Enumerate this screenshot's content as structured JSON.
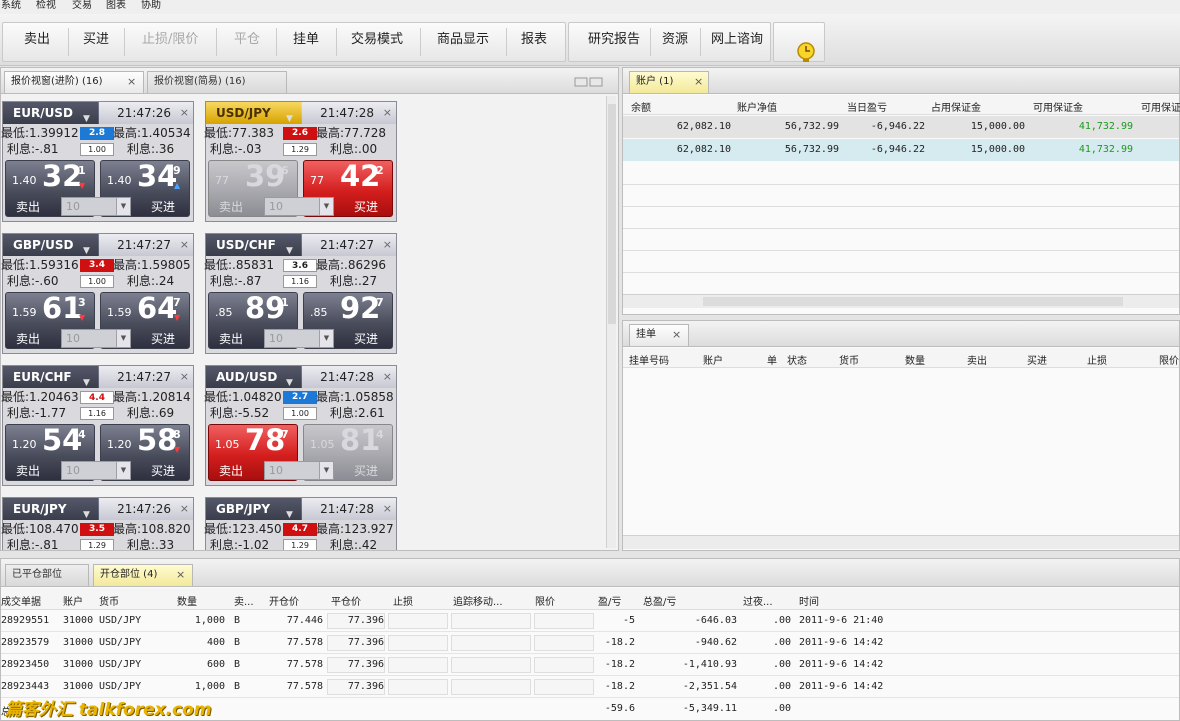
{
  "menu": [
    "系统",
    "检视",
    "交易",
    "图表",
    "协助"
  ],
  "toolbar": {
    "buttons": [
      {
        "label": "卖出",
        "enabled": true
      },
      {
        "label": "买进",
        "enabled": true
      },
      {
        "label": "止损/限价",
        "enabled": false
      },
      {
        "label": "平仓",
        "enabled": false
      },
      {
        "label": "挂单",
        "enabled": true
      },
      {
        "label": "交易模式",
        "enabled": true
      },
      {
        "label": "商品显示",
        "enabled": true
      },
      {
        "label": "报表",
        "enabled": true
      },
      {
        "label": "研究报告",
        "enabled": true
      },
      {
        "label": "资源",
        "enabled": true
      },
      {
        "label": "网上谘询",
        "enabled": true
      }
    ],
    "clock_icon": "clock-icon"
  },
  "quotes_panel": {
    "tabs": [
      {
        "label": "报价视窗(进阶) (16)",
        "active": true
      },
      {
        "label": "报价视窗(简易) (16)",
        "active": false
      }
    ],
    "close_icon": "×",
    "cards": [
      {
        "symbol": "EUR/USD",
        "time": "21:47:26",
        "low": "最低:1.39912",
        "high": "最高:1.40534",
        "spread": "2.8",
        "spread_color": "blue",
        "int_a": "利息:-.81",
        "lot": "1.00",
        "int_b": "利息:.36",
        "sell_small": "1.40",
        "sell_main": "32",
        "sell_sup": "1",
        "sell_dir": "down",
        "sell_label": "卖出",
        "buy_small": "1.40",
        "buy_main": "34",
        "buy_sup": "9",
        "buy_dir": "up",
        "buy_label": "买进",
        "amount": "10",
        "state": "normal",
        "highlight": false
      },
      {
        "symbol": "USD/JPY",
        "time": "21:47:28",
        "low": "最低:77.383",
        "high": "最高:77.728",
        "spread": "2.6",
        "spread_color": "red",
        "int_a": "利息:-.03",
        "lot": "1.29",
        "int_b": "利息:.00",
        "sell_small": "77",
        "sell_main": "39",
        "sell_sup": "6",
        "sell_dir": "",
        "sell_label": "卖出",
        "buy_small": "77",
        "buy_main": "42",
        "buy_sup": "2",
        "buy_dir": "",
        "buy_label": "买进",
        "amount": "10",
        "state": "buy-red",
        "highlight": true
      },
      {
        "symbol": "GBP/USD",
        "time": "21:47:27",
        "low": "最低:1.59316",
        "high": "最高:1.59805",
        "spread": "3.4",
        "spread_color": "red",
        "int_a": "利息:-.60",
        "lot": "1.00",
        "int_b": "利息:.24",
        "sell_small": "1.59",
        "sell_main": "61",
        "sell_sup": "3",
        "sell_dir": "down",
        "sell_label": "卖出",
        "buy_small": "1.59",
        "buy_main": "64",
        "buy_sup": "7",
        "buy_dir": "down",
        "buy_label": "买进",
        "amount": "10",
        "state": "normal",
        "highlight": false
      },
      {
        "symbol": "USD/CHF",
        "time": "21:47:27",
        "low": "最低:.85831",
        "high": "最高:.86296",
        "spread": "3.6",
        "spread_color": "white",
        "int_a": "利息:-.87",
        "lot": "1.16",
        "int_b": "利息:.27",
        "sell_small": ".85",
        "sell_main": "89",
        "sell_sup": "1",
        "sell_dir": "",
        "sell_label": "卖出",
        "buy_small": ".85",
        "buy_main": "92",
        "buy_sup": "7",
        "buy_dir": "",
        "buy_label": "买进",
        "amount": "10",
        "state": "normal",
        "highlight": false
      },
      {
        "symbol": "EUR/CHF",
        "time": "21:47:27",
        "low": "最低:1.20463",
        "high": "最高:1.20814",
        "spread": "4.4",
        "spread_color": "white-red",
        "int_a": "利息:-1.77",
        "lot": "1.16",
        "int_b": "利息:.69",
        "sell_small": "1.20",
        "sell_main": "54",
        "sell_sup": "4",
        "sell_dir": "",
        "sell_label": "卖出",
        "buy_small": "1.20",
        "buy_main": "58",
        "buy_sup": "8",
        "buy_dir": "down",
        "buy_label": "买进",
        "amount": "10",
        "state": "normal",
        "highlight": false
      },
      {
        "symbol": "AUD/USD",
        "time": "21:47:28",
        "low": "最低:1.04820",
        "high": "最高:1.05858",
        "spread": "2.7",
        "spread_color": "blue",
        "int_a": "利息:-5.52",
        "lot": "1.00",
        "int_b": "利息:2.61",
        "sell_small": "1.05",
        "sell_main": "78",
        "sell_sup": "7",
        "sell_dir": "",
        "sell_label": "卖出",
        "buy_small": "1.05",
        "buy_main": "81",
        "buy_sup": "4",
        "buy_dir": "",
        "buy_label": "买进",
        "amount": "10",
        "state": "sell-red",
        "highlight": false
      },
      {
        "symbol": "EUR/JPY",
        "time": "21:47:26",
        "low": "最低:108.470",
        "high": "最高:108.820",
        "spread": "3.5",
        "spread_color": "red",
        "int_a": "利息:-.81",
        "lot": "1.29",
        "int_b": "利息:.33",
        "highlight": false
      },
      {
        "symbol": "GBP/JPY",
        "time": "21:47:28",
        "low": "最低:123.450",
        "high": "最高:123.927",
        "spread": "4.7",
        "spread_color": "red",
        "int_a": "利息:-1.02",
        "lot": "1.29",
        "int_b": "利息:.42",
        "highlight": false
      }
    ]
  },
  "account_panel": {
    "tab": "账户 (1)",
    "columns": [
      "余额",
      "账户净值",
      "当日盈亏",
      "占用保证金",
      "可用保证金",
      "可用保证"
    ],
    "rows": [
      [
        "62,082.10",
        "56,732.99",
        "-6,946.22",
        "15,000.00",
        "41,732.99"
      ],
      [
        "62,082.10",
        "56,732.99",
        "-6,946.22",
        "15,000.00",
        "41,732.99"
      ]
    ]
  },
  "orders_panel": {
    "tab": "挂单",
    "columns": [
      "挂单号码",
      "账户",
      "单",
      "状态",
      "货币",
      "数量",
      "卖出",
      "买进",
      "止损",
      "限价"
    ]
  },
  "positions_panel": {
    "tabs": [
      {
        "label": "已平仓部位",
        "active": false
      },
      {
        "label": "开仓部位 (4)",
        "active": true
      }
    ],
    "columns": [
      "成交单据",
      "账户",
      "货币",
      "数量",
      "卖...",
      "开仓价",
      "平仓价",
      "止损",
      "追踪移动...",
      "限价",
      "盈/亏",
      "总盈/亏",
      "过夜...",
      "时间"
    ],
    "rows": [
      [
        "28929551",
        "31000",
        "USD/JPY",
        "1,000",
        "B",
        "77.446",
        "77.396",
        "-5",
        "-646.03",
        ".00",
        "2011-9-6 21:40"
      ],
      [
        "28923579",
        "31000",
        "USD/JPY",
        "400",
        "B",
        "77.578",
        "77.396",
        "-18.2",
        "-940.62",
        ".00",
        "2011-9-6 14:42"
      ],
      [
        "28923450",
        "31000",
        "USD/JPY",
        "600",
        "B",
        "77.578",
        "77.396",
        "-18.2",
        "-1,410.93",
        ".00",
        "2011-9-6 14:42"
      ],
      [
        "28923443",
        "31000",
        "USD/JPY",
        "1,000",
        "B",
        "77.578",
        "77.396",
        "-18.2",
        "-2,351.54",
        ".00",
        "2011-9-6 14:42"
      ]
    ],
    "total": {
      "label": "总",
      "pl": "-59.6",
      "total_pl": "-5,349.11",
      "rollover": ".00"
    }
  },
  "watermark": "篇客外汇 talkforex.com",
  "colors": {
    "sell_red": "#d41e1e",
    "spread_blue": "#1c79d6",
    "positive_green": "#1a9a1a",
    "highlight_gold": "#e2b418"
  }
}
